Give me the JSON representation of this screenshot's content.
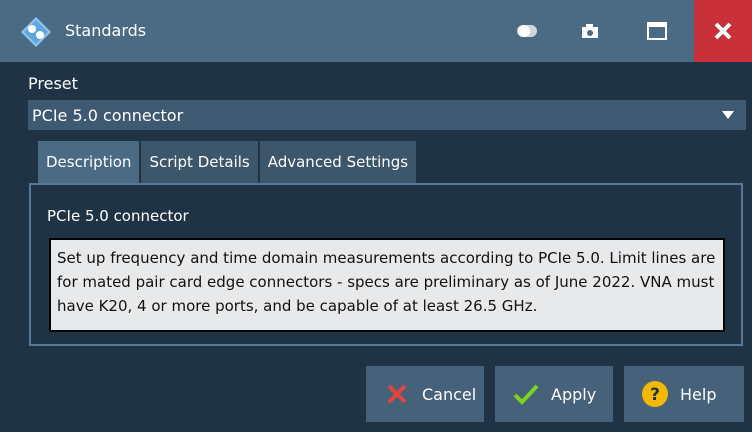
{
  "window": {
    "title": "Standards",
    "close_color": "#c8313a"
  },
  "preset": {
    "label": "Preset",
    "selected": "PCIe 5.0 connector"
  },
  "tabs": [
    {
      "label": "Description",
      "active": true
    },
    {
      "label": "Script Details",
      "active": false
    },
    {
      "label": "Advanced Settings",
      "active": false
    }
  ],
  "description": {
    "heading": "PCIe 5.0 connector",
    "text": "Set up frequency and time domain measurements according to PCIe 5.0. Limit lines are for mated pair card edge connectors - specs are preliminary as of June 2022. VNA must have K20, 4 or more ports, and be capable of at least 26.5 GHz."
  },
  "buttons": {
    "cancel": "Cancel",
    "apply": "Apply",
    "help": "Help"
  },
  "icons": {
    "cancel": "x-icon",
    "apply": "checkmark-icon",
    "help": "question-icon",
    "titlebar": [
      "toggle-icon",
      "camera-icon",
      "maximize-icon",
      "close-icon"
    ]
  }
}
